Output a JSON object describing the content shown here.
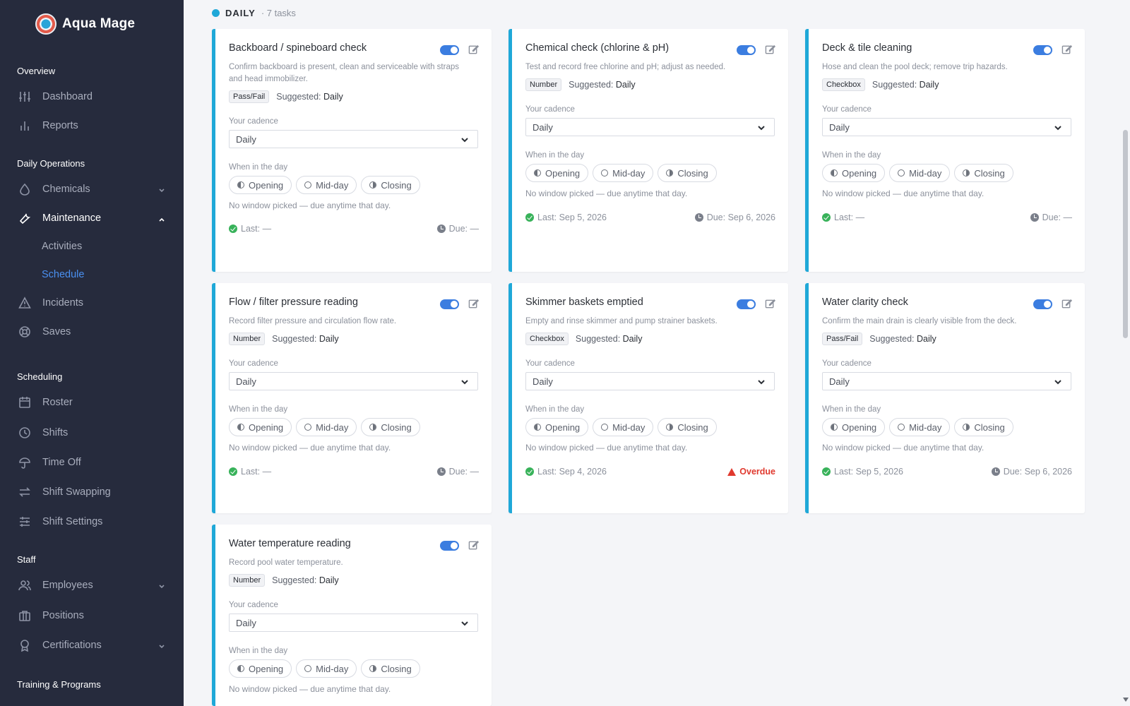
{
  "app": {
    "name": "Aqua Mage"
  },
  "sidebar": {
    "sections": {
      "overview": "Overview",
      "daily_ops": "Daily Operations",
      "scheduling": "Scheduling",
      "staff": "Staff",
      "training": "Training & Programs"
    },
    "items": {
      "dashboard": "Dashboard",
      "reports": "Reports",
      "chemicals": "Chemicals",
      "maintenance": "Maintenance",
      "activities": "Activities",
      "schedule": "Schedule",
      "incidents": "Incidents",
      "saves": "Saves",
      "roster": "Roster",
      "shifts": "Shifts",
      "time_off": "Time Off",
      "shift_swapping": "Shift Swapping",
      "shift_settings": "Shift Settings",
      "employees": "Employees",
      "positions": "Positions",
      "certifications": "Certifications"
    }
  },
  "group": {
    "title": "DAILY",
    "count": "· 7 tasks"
  },
  "labels": {
    "suggested": "Suggested:",
    "cadence": "Your cadence",
    "when": "When in the day",
    "opening": "Opening",
    "midday": "Mid-day",
    "closing": "Closing",
    "no_window": "No window picked — due anytime that day."
  },
  "cards": [
    {
      "title": "Backboard / spineboard check",
      "desc": "Confirm backboard is present, clean and serviceable with straps and head immobilizer.",
      "type": "Pass/Fail",
      "suggested": "Daily",
      "cadence": "Daily",
      "last": "Last: —",
      "due": "Due: —",
      "enabled": true
    },
    {
      "title": "Chemical check (chlorine & pH)",
      "desc": "Test and record free chlorine and pH; adjust as needed.",
      "type": "Number",
      "suggested": "Daily",
      "cadence": "Daily",
      "last": "Last: Sep 5, 2026",
      "due": "Due: Sep 6, 2026",
      "enabled": true
    },
    {
      "title": "Deck & tile cleaning",
      "desc": "Hose and clean the pool deck; remove trip hazards.",
      "type": "Checkbox",
      "suggested": "Daily",
      "cadence": "Daily",
      "last": "Last: —",
      "due": "Due: —",
      "enabled": true
    },
    {
      "title": "Flow / filter pressure reading",
      "desc": "Record filter pressure and circulation flow rate.",
      "type": "Number",
      "suggested": "Daily",
      "cadence": "Daily",
      "last": "Last: —",
      "due": "Due: —",
      "enabled": true
    },
    {
      "title": "Skimmer baskets emptied",
      "desc": "Empty and rinse skimmer and pump strainer baskets.",
      "type": "Checkbox",
      "suggested": "Daily",
      "cadence": "Daily",
      "last": "Last: Sep 4, 2026",
      "due": "Overdue",
      "enabled": true
    },
    {
      "title": "Water clarity check",
      "desc": "Confirm the main drain is clearly visible from the deck.",
      "type": "Pass/Fail",
      "suggested": "Daily",
      "cadence": "Daily",
      "last": "Last: Sep 5, 2026",
      "due": "Due: Sep 6, 2026",
      "enabled": true
    },
    {
      "title": "Water temperature reading",
      "desc": "Record pool water temperature.",
      "type": "Number",
      "suggested": "Daily",
      "cadence": "Daily",
      "last": "",
      "due": "",
      "enabled": true
    }
  ],
  "colors": {
    "accent": "#1fa8d8",
    "toggle": "#3b7de0",
    "sidebar_bg": "#262b3d",
    "ok": "#38b25a",
    "overdue": "#e0392e"
  }
}
